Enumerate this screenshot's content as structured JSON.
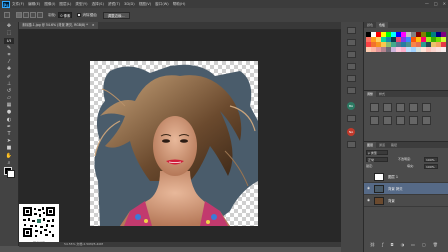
{
  "app": {
    "logo": "Ps"
  },
  "menubar": {
    "items": [
      "文件(F)",
      "编辑(E)",
      "图像(I)",
      "图层(L)",
      "类型(Y)",
      "选择(S)",
      "滤镜(T)",
      "3D(D)",
      "视图(V)",
      "窗口(W)",
      "帮助(H)"
    ],
    "window_controls": [
      "—",
      "□",
      "✕"
    ]
  },
  "optionsbar": {
    "feather_label": "羽化:",
    "feather_value": "0 像素",
    "antialias_label": "消除锯齿",
    "refine_button": "调整边缘..."
  },
  "document": {
    "tab_title": "未标题-1.jpg @ 54.6% (背景 拷贝, RGB/8) *",
    "close_glyph": "×"
  },
  "statusbar": {
    "text": "54.55%    文档:2.50M/5.40M"
  },
  "watermark": {
    "caption": "同步学习"
  },
  "panels": {
    "swatch_tabs": [
      "颜色",
      "色板"
    ],
    "adj_tabs": [
      "调整",
      "样式"
    ],
    "layers_tabs": [
      "图层",
      "通道",
      "路径"
    ],
    "layers_kind": "ρ 类型",
    "blend_mode": "正常",
    "opacity_label": "不透明度:",
    "opacity_value": "100%",
    "fill_label": "填充:",
    "fill_value": "100%",
    "lock_label": "锁定:",
    "layers": [
      {
        "name": "图层 1",
        "selected": false,
        "visible": false
      },
      {
        "name": "背景 拷贝",
        "selected": true,
        "visible": true
      },
      {
        "name": "背景",
        "selected": false,
        "visible": true
      }
    ],
    "dock_badges": [
      "BA",
      "NA"
    ]
  },
  "swatch_colors": [
    "#000000",
    "#ffffff",
    "#ff0000",
    "#ffff00",
    "#00ff00",
    "#00ffff",
    "#0000ff",
    "#ff00ff",
    "#c0c0c0",
    "#808080",
    "#800000",
    "#808000",
    "#008000",
    "#008080",
    "#000080",
    "#800080",
    "#ff6f61",
    "#ff9f1c",
    "#ffd166",
    "#06d6a0",
    "#118ab2",
    "#073b4c",
    "#ef476f",
    "#8338ec",
    "#3a86ff",
    "#fb5607",
    "#ffbe0b",
    "#ff006e",
    "#9ef01a",
    "#38b000",
    "#70e000",
    "#ccff33",
    "#f94144",
    "#f3722c",
    "#f8961e",
    "#f9c74f",
    "#90be6d",
    "#43aa8b",
    "#577590",
    "#277da1",
    "#4d908e",
    "#f9844a",
    "#e76f51",
    "#2a9d8f",
    "#264653",
    "#e9c46a",
    "#f4a261",
    "#e63946",
    "#ffcdb2",
    "#ffb4a2",
    "#e5989b",
    "#b5838d",
    "#6d6875",
    "#cdb4db",
    "#ffc8dd",
    "#ffafcc",
    "#bde0fe",
    "#a2d2ff",
    "#d8e2dc",
    "#ffe5d9",
    "#fec5bb",
    "#fcd5ce",
    "#fae1dd",
    "#f8edeb"
  ]
}
